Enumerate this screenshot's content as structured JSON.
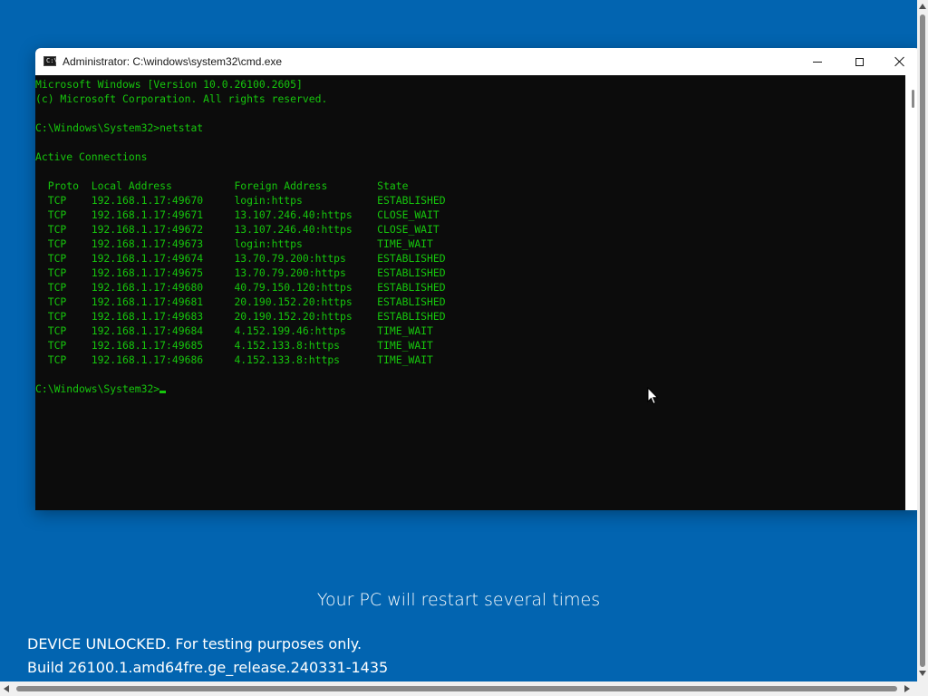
{
  "window": {
    "title": "Administrator: C:\\windows\\system32\\cmd.exe",
    "icon": "cmd-icon",
    "icon_text": "C:\\",
    "controls": [
      "minimize-icon",
      "maximize-icon",
      "close-icon"
    ]
  },
  "console": {
    "text_color": "#16c60c",
    "background": "#0c0c0c",
    "lines": [
      "Microsoft Windows [Version 10.0.26100.2605]",
      "(c) Microsoft Corporation. All rights reserved.",
      "",
      "C:\\Windows\\System32>netstat",
      "",
      "Active Connections",
      "",
      "  Proto  Local Address          Foreign Address        State",
      "  TCP    192.168.1.17:49670     login:https            ESTABLISHED",
      "  TCP    192.168.1.17:49671     13.107.246.40:https    CLOSE_WAIT",
      "  TCP    192.168.1.17:49672     13.107.246.40:https    CLOSE_WAIT",
      "  TCP    192.168.1.17:49673     login:https            TIME_WAIT",
      "  TCP    192.168.1.17:49674     13.70.79.200:https     ESTABLISHED",
      "  TCP    192.168.1.17:49675     13.70.79.200:https     ESTABLISHED",
      "  TCP    192.168.1.17:49680     40.79.150.120:https    ESTABLISHED",
      "  TCP    192.168.1.17:49681     20.190.152.20:https    ESTABLISHED",
      "  TCP    192.168.1.17:49683     20.190.152.20:https    ESTABLISHED",
      "  TCP    192.168.1.17:49684     4.152.199.46:https     TIME_WAIT",
      "  TCP    192.168.1.17:49685     4.152.133.8:https      TIME_WAIT",
      "  TCP    192.168.1.17:49686     4.152.133.8:https      TIME_WAIT",
      ""
    ],
    "prompt": "C:\\Windows\\System32>"
  },
  "setup": {
    "background": "#0264b0",
    "restart_message": "Your PC will restart several times",
    "device_unlocked": "DEVICE UNLOCKED. For testing purposes only.",
    "build": "Build 26100.1.amd64fre.ge_release.240331-1435"
  }
}
